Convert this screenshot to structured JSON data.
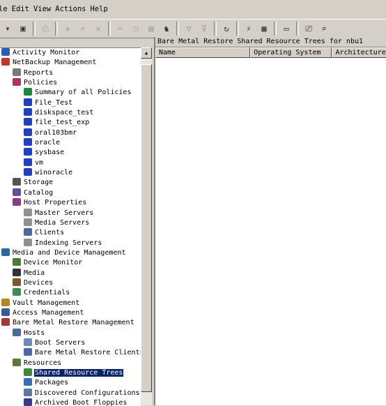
{
  "menu": [
    "le",
    "Edit",
    "View",
    "Actions",
    "Help"
  ],
  "toolbar": {
    "buttons": [
      {
        "icon": "dropdown-arrow-icon",
        "glyph": "▾",
        "enabled": true
      },
      {
        "icon": "show-tree-icon",
        "glyph": "▣",
        "enabled": true
      },
      {
        "sep": true
      },
      {
        "icon": "print-icon",
        "glyph": "⎙",
        "enabled": false
      },
      {
        "sep": true
      },
      {
        "icon": "new-icon",
        "glyph": "✳",
        "enabled": false
      },
      {
        "icon": "undo-icon",
        "glyph": "↶",
        "enabled": false
      },
      {
        "icon": "delete-icon",
        "glyph": "✕",
        "enabled": false
      },
      {
        "sep": true
      },
      {
        "icon": "cut-icon",
        "glyph": "✂",
        "enabled": false
      },
      {
        "icon": "copy-icon",
        "glyph": "❐",
        "enabled": false
      },
      {
        "icon": "paste-icon",
        "glyph": "▤",
        "enabled": false
      },
      {
        "icon": "find-icon",
        "glyph": "♞",
        "enabled": true
      },
      {
        "sep": true
      },
      {
        "icon": "filter-icon",
        "glyph": "▽",
        "enabled": false
      },
      {
        "icon": "clear-filter-icon",
        "glyph": "⊽",
        "enabled": false
      },
      {
        "sep": true
      },
      {
        "icon": "refresh-icon",
        "glyph": "↻",
        "enabled": true
      },
      {
        "sep": true
      },
      {
        "icon": "connect-icon",
        "glyph": "⚡",
        "enabled": true
      },
      {
        "icon": "properties-icon",
        "glyph": "▦",
        "enabled": true
      },
      {
        "sep": true
      },
      {
        "icon": "monitor-icon",
        "glyph": "▭",
        "enabled": true
      },
      {
        "sep": true
      },
      {
        "icon": "remote-console-icon",
        "glyph": "⎚",
        "enabled": true
      },
      {
        "icon": "view-icon",
        "glyph": "⌕",
        "enabled": true
      }
    ]
  },
  "tree": [
    {
      "label": "Activity Monitor",
      "indent": 0,
      "icon": "activity-monitor-icon",
      "color": "#2a5bb8"
    },
    {
      "label": "NetBackup Management",
      "indent": 0,
      "icon": "netbackup-icon",
      "color": "#c0392b"
    },
    {
      "label": "Reports",
      "indent": 1,
      "icon": "reports-icon",
      "color": "#7a7a7a"
    },
    {
      "label": "Policies",
      "indent": 1,
      "icon": "policies-icon",
      "color": "#b03060"
    },
    {
      "label": "Summary of all Policies",
      "indent": 2,
      "icon": "policy-summary-icon",
      "color": "#1a8a3a"
    },
    {
      "label": "File_Test",
      "indent": 2,
      "icon": "policy-icon",
      "color": "#2040c0"
    },
    {
      "label": "diskspace_test",
      "indent": 2,
      "icon": "policy-icon",
      "color": "#2040c0"
    },
    {
      "label": "file_test_exp",
      "indent": 2,
      "icon": "policy-icon",
      "color": "#2040c0"
    },
    {
      "label": "oral103bmr",
      "indent": 2,
      "icon": "policy-icon",
      "color": "#2040c0"
    },
    {
      "label": "oracle",
      "indent": 2,
      "icon": "policy-icon",
      "color": "#2040c0"
    },
    {
      "label": "sysbase",
      "indent": 2,
      "icon": "policy-icon",
      "color": "#2040c0"
    },
    {
      "label": "vm",
      "indent": 2,
      "icon": "policy-icon",
      "color": "#2040c0"
    },
    {
      "label": "winoracle",
      "indent": 2,
      "icon": "policy-icon",
      "color": "#2040c0"
    },
    {
      "label": "Storage",
      "indent": 1,
      "icon": "storage-icon",
      "color": "#555555"
    },
    {
      "label": "Catalog",
      "indent": 1,
      "icon": "catalog-icon",
      "color": "#6a4a9a"
    },
    {
      "label": "Host Properties",
      "indent": 1,
      "icon": "host-properties-icon",
      "color": "#8a3a8a"
    },
    {
      "label": "Master Servers",
      "indent": 2,
      "icon": "server-icon",
      "color": "#909090"
    },
    {
      "label": "Media Servers",
      "indent": 2,
      "icon": "server-icon",
      "color": "#909090"
    },
    {
      "label": "Clients",
      "indent": 2,
      "icon": "client-icon",
      "color": "#4a6aa0"
    },
    {
      "label": "Indexing Servers",
      "indent": 2,
      "icon": "server-icon",
      "color": "#909090"
    },
    {
      "label": "Media and Device Management",
      "indent": 0,
      "icon": "media-device-icon",
      "color": "#2a6a9a"
    },
    {
      "label": "Device Monitor",
      "indent": 1,
      "icon": "device-monitor-icon",
      "color": "#4a7a3a"
    },
    {
      "label": "Media",
      "indent": 1,
      "icon": "media-icon",
      "color": "#333333"
    },
    {
      "label": "Devices",
      "indent": 1,
      "icon": "devices-icon",
      "color": "#7a5a2a"
    },
    {
      "label": "Credentials",
      "indent": 1,
      "icon": "credentials-icon",
      "color": "#3a8a5a"
    },
    {
      "label": "Vault Management",
      "indent": 0,
      "icon": "vault-icon",
      "color": "#b08a20"
    },
    {
      "label": "Access Management",
      "indent": 0,
      "icon": "access-icon",
      "color": "#3a5a9a"
    },
    {
      "label": "Bare Metal Restore Management",
      "indent": 0,
      "icon": "bmr-icon",
      "color": "#a03a3a"
    },
    {
      "label": "Hosts",
      "indent": 1,
      "icon": "hosts-icon",
      "color": "#4a6a9a"
    },
    {
      "label": "Boot Servers",
      "indent": 2,
      "icon": "boot-server-icon",
      "color": "#6a8aba"
    },
    {
      "label": "Bare Metal Restore Clients",
      "indent": 2,
      "icon": "bmr-client-icon",
      "color": "#4a6aa0"
    },
    {
      "label": "Resources",
      "indent": 1,
      "icon": "resources-icon",
      "color": "#5a7a3a"
    },
    {
      "label": "Shared Resource Trees",
      "indent": 2,
      "icon": "shared-resource-tree-icon",
      "color": "#3a8a3a",
      "selected": true
    },
    {
      "label": "Packages",
      "indent": 2,
      "icon": "packages-icon",
      "color": "#3a6aba"
    },
    {
      "label": "Discovered Configurations",
      "indent": 2,
      "icon": "discovered-config-icon",
      "color": "#5a7a9a"
    },
    {
      "label": "Archived Boot Floppies",
      "indent": 2,
      "icon": "floppy-icon",
      "color": "#3a3a8a"
    }
  ],
  "right_pane": {
    "title": "Bare Metal Restore Shared Resource Trees for nbu1",
    "columns": [
      "Name",
      "Operating System",
      "Architecture"
    ]
  }
}
